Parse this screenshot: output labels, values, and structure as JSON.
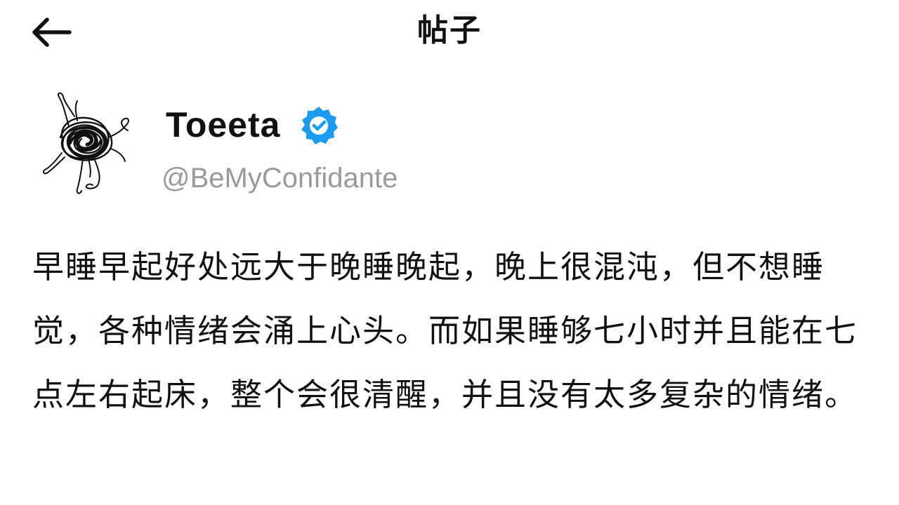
{
  "header": {
    "title": "帖子",
    "back_icon": "arrow-left-icon"
  },
  "author": {
    "display_name": "Toeeta",
    "handle": "@BeMyConfidante",
    "verified_icon": "verified-badge-icon",
    "verified_color": "#1d9bf0",
    "avatar_icon": "scribble-figure-avatar"
  },
  "post": {
    "text": "早睡早起好处远大于晚睡晚起，晚上很混沌，但不想睡觉，各种情绪会涌上心头。而如果睡够七小时并且能在七点左右起床，整个会很清醒，并且没有太多复杂的情绪。"
  }
}
